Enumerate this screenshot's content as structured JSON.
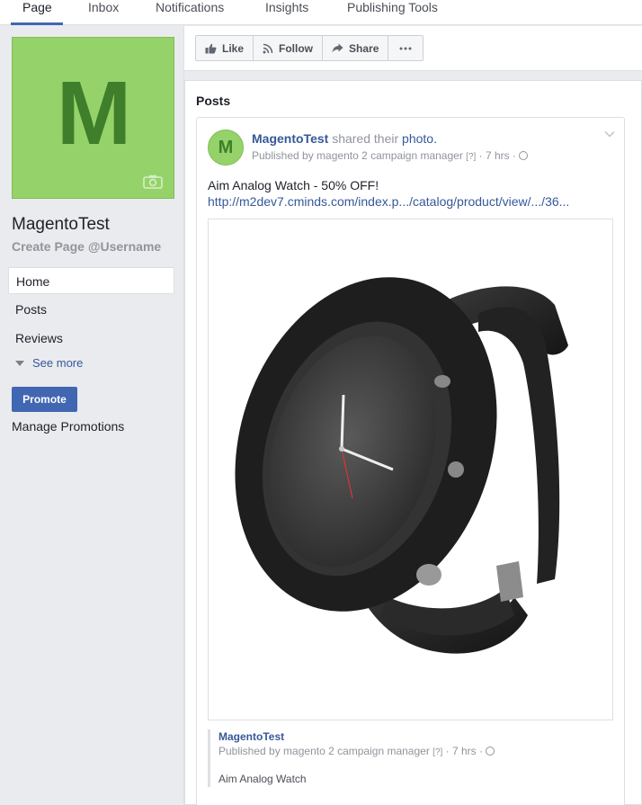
{
  "tabs": [
    {
      "label": "Page",
      "active": true
    },
    {
      "label": "Inbox",
      "active": false
    },
    {
      "label": "Notifications",
      "active": false
    },
    {
      "label": "Insights",
      "active": false
    },
    {
      "label": "Publishing Tools",
      "active": false
    }
  ],
  "sidebar": {
    "cover_letter": "M",
    "page_name": "MagentoTest",
    "username_link": "Create Page @Username",
    "nav": [
      {
        "label": "Home",
        "active": true
      },
      {
        "label": "Posts",
        "active": false
      },
      {
        "label": "Reviews",
        "active": false
      }
    ],
    "see_more": "See more",
    "promote": "Promote",
    "manage_promotions": "Manage Promotions"
  },
  "action_bar": {
    "like": "Like",
    "follow": "Follow",
    "share": "Share"
  },
  "posts": {
    "title": "Posts",
    "post": {
      "avatar_letter": "M",
      "author": "MagentoTest",
      "action_text": " shared their ",
      "action_link": "photo.",
      "published_by": "Published by magento 2 campaign manager",
      "help_marker": "[?]",
      "time": "· 7 hrs ·",
      "text": "Aim Analog Watch - 50% OFF!",
      "url": "http://m2dev7.cminds.com/index.p.../catalog/product/view/.../36...",
      "attachment": {
        "name": "MagentoTest",
        "published_by": "Published by magento 2 campaign manager",
        "help_marker": "[?]",
        "time": "· 7 hrs ·",
        "description": "Aim Analog Watch"
      }
    }
  },
  "colors": {
    "brand_blue": "#4267b2",
    "link_blue": "#365899",
    "cover_green": "#95d36a",
    "letter_green": "#3f7e2a"
  }
}
